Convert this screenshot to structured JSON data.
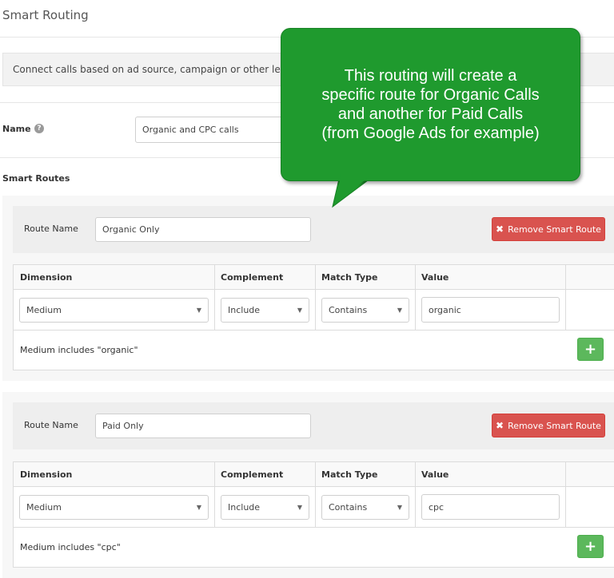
{
  "page": {
    "title": "Smart Routing",
    "info_text": "Connect calls based on ad source, campaign or other lead detai"
  },
  "name_field": {
    "label": "Name",
    "help_icon": "question-circle-icon",
    "value": "Organic and CPC calls"
  },
  "smart_routes": {
    "title": "Smart Routes",
    "routes": [
      {
        "route_name_label": "Route Name",
        "route_name_value": "Organic Only",
        "remove_label": "Remove Smart Route",
        "columns": [
          "Dimension",
          "Complement",
          "Match Type",
          "Value"
        ],
        "dimension": "Medium",
        "complement": "Include",
        "match_type": "Contains",
        "value": "organic",
        "summary": "Medium includes \"organic\"",
        "add_label": "+"
      },
      {
        "route_name_label": "Route Name",
        "route_name_value": "Paid Only",
        "remove_label": "Remove Smart Route",
        "columns": [
          "Dimension",
          "Complement",
          "Match Type",
          "Value"
        ],
        "dimension": "Medium",
        "complement": "Include",
        "match_type": "Contains",
        "value": "cpc",
        "summary": "Medium includes \"cpc\"",
        "add_label": "+"
      }
    ]
  },
  "callout": {
    "lines": [
      "This routing will create a",
      "specific route for Organic Calls",
      "and another for Paid Calls",
      "(from Google Ads for example)"
    ],
    "color": "#1f9a2e"
  },
  "colors": {
    "danger": "#d9534f",
    "success": "#5cb85c"
  }
}
